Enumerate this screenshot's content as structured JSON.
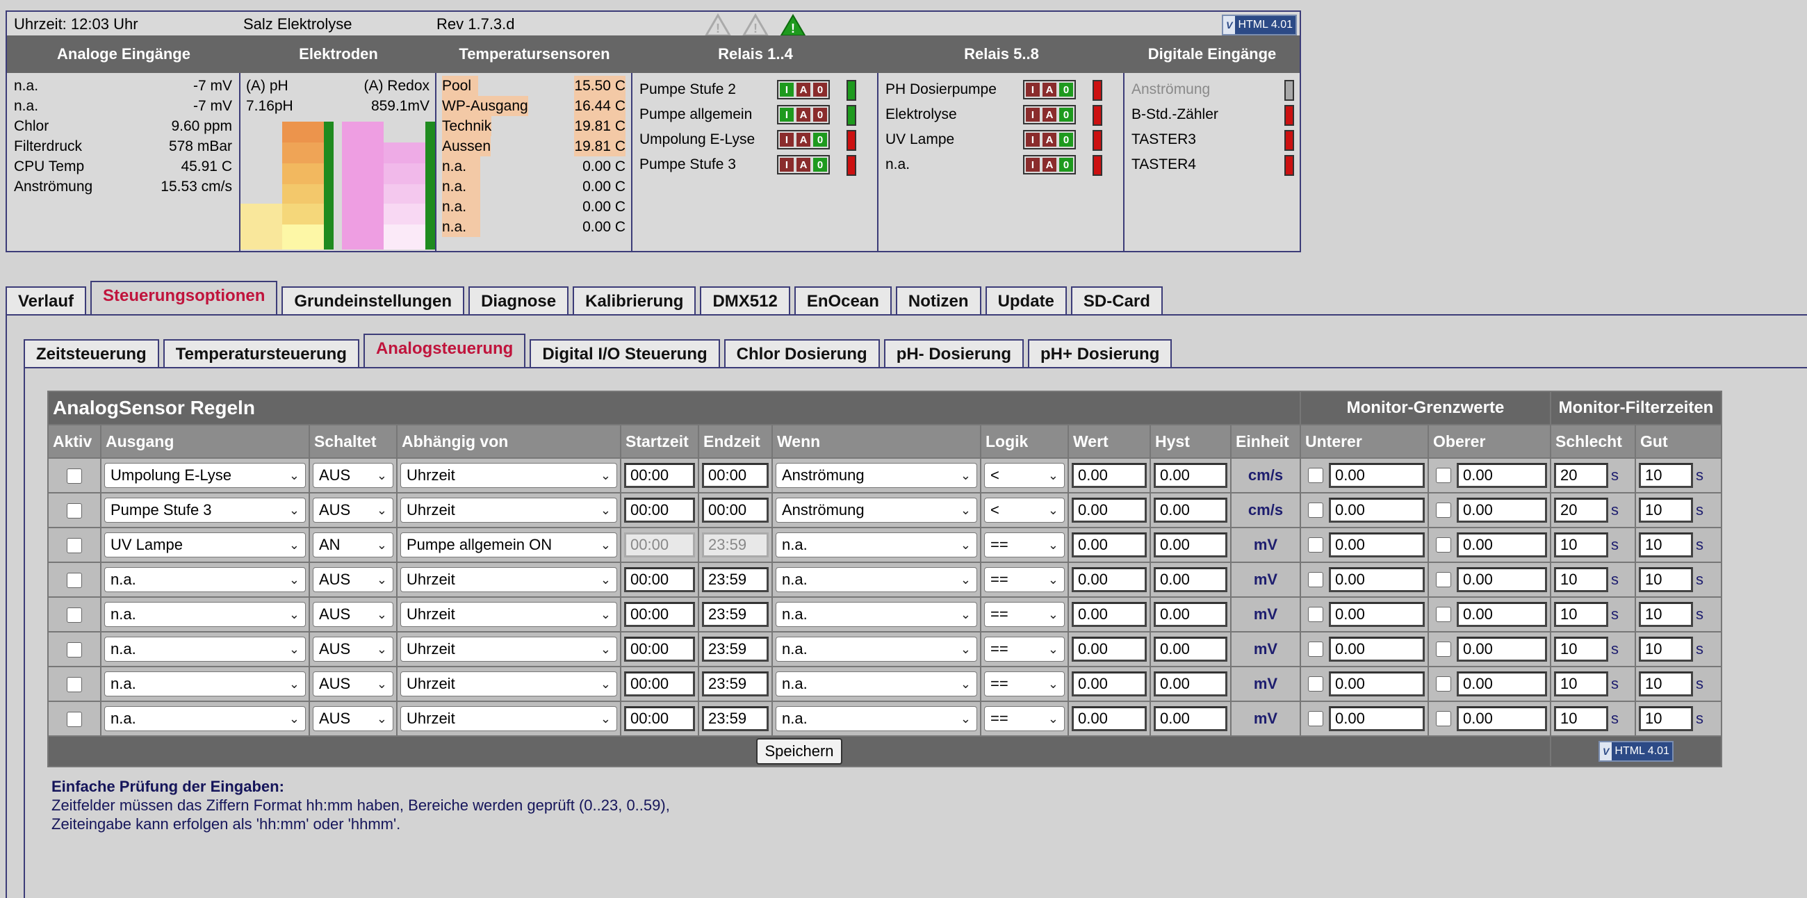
{
  "status": {
    "time": "Uhrzeit: 12:03 Uhr",
    "system": "Salz Elektrolyse",
    "revision": "Rev 1.7.3.d",
    "validator": {
      "left": "V",
      "right": "HTML 4.01"
    }
  },
  "panel": {
    "headers": {
      "analog": "Analoge Eingänge",
      "electrodes": "Elektroden",
      "temps": "Temperatursensoren",
      "relais14": "Relais 1..4",
      "relais58": "Relais 5..8",
      "digital": "Digitale Eingänge"
    },
    "analog": [
      {
        "label": "n.a.",
        "value": "-7 mV"
      },
      {
        "label": "n.a.",
        "value": "-7 mV"
      },
      {
        "label": "Chlor",
        "value": "9.60 ppm"
      },
      {
        "label": "Filterdruck",
        "value": "578 mBar"
      },
      {
        "label": "CPU Temp",
        "value": "45.91 C"
      },
      {
        "label": "Anströmung",
        "value": "15.53 cm/s"
      }
    ],
    "electrodes": {
      "ph_label": "(A) pH",
      "redox_label": "(A) Redox",
      "ph_value": "7.16pH",
      "redox_value": "859.1mV",
      "ph_level": 0.3,
      "redox_level": 0.62
    },
    "temps": [
      {
        "label": "Pool",
        "value": "15.50 C"
      },
      {
        "label": "WP-Ausgang",
        "value": "16.44 C"
      },
      {
        "label": "Technik",
        "value": "19.81 C"
      },
      {
        "label": "Aussen",
        "value": "19.81 C"
      },
      {
        "label": "n.a.",
        "value": "0.00 C"
      },
      {
        "label": "n.a.",
        "value": "0.00 C"
      },
      {
        "label": "n.a.",
        "value": "0.00 C"
      },
      {
        "label": "n.a.",
        "value": "0.00 C"
      }
    ],
    "relais14": [
      {
        "label": "Pumpe Stufe 2",
        "state": "I",
        "on": true
      },
      {
        "label": "Pumpe allgemein",
        "state": "I",
        "on": true
      },
      {
        "label": "Umpolung E-Lyse",
        "state": "0",
        "on": false
      },
      {
        "label": "Pumpe Stufe 3",
        "state": "0",
        "on": false
      }
    ],
    "relais58": [
      {
        "label": "PH Dosierpumpe",
        "state": "0",
        "on": false
      },
      {
        "label": "Elektrolyse",
        "state": "0",
        "on": false
      },
      {
        "label": "UV Lampe",
        "state": "0",
        "on": false
      },
      {
        "label": "n.a.",
        "state": "0",
        "on": false
      }
    ],
    "relais_buttons": [
      "I",
      "A",
      "0"
    ],
    "digital": [
      {
        "label": "Anströmung",
        "active": false,
        "dim": true
      },
      {
        "label": "B-Std.-Zähler",
        "active": true,
        "dim": false
      },
      {
        "label": "TASTER3",
        "active": true,
        "dim": false
      },
      {
        "label": "TASTER4",
        "active": true,
        "dim": false
      }
    ]
  },
  "tabs_main": [
    "Verlauf",
    "Steuerungsoptionen",
    "Grundeinstellungen",
    "Diagnose",
    "Kalibrierung",
    "DMX512",
    "EnOcean",
    "Notizen",
    "Update",
    "SD-Card"
  ],
  "tabs_main_active": 1,
  "tabs_sub": [
    "Zeitsteuerung",
    "Temperatursteuerung",
    "Analogsteuerung",
    "Digital I/O Steuerung",
    "Chlor Dosierung",
    "pH- Dosierung",
    "pH+ Dosierung"
  ],
  "tabs_sub_active": 2,
  "table": {
    "title": "AnalogSensor Regeln",
    "monitor_limits": "Monitor-Grenzwerte",
    "monitor_filter": "Monitor-Filterzeiten",
    "columns": [
      "Aktiv",
      "Ausgang",
      "Schaltet",
      "Abhängig von",
      "Startzeit",
      "Endzeit",
      "Wenn",
      "Logik",
      "Wert",
      "Hyst",
      "Einheit",
      "Unterer",
      "Oberer",
      "Schlecht",
      "Gut"
    ],
    "seconds_suffix": "s",
    "rows": [
      {
        "ausgang": "Umpolung E-Lyse",
        "schaltet": "AUS",
        "abh": "Uhrzeit",
        "start": "00:00",
        "end": "00:00",
        "wenn": "Anströmung",
        "logik": "<",
        "wert": "0.00",
        "hyst": "0.00",
        "einheit": "cm/s",
        "unterer": "0.00",
        "oberer": "0.00",
        "schlecht": "20",
        "gut": "10",
        "disabled": false
      },
      {
        "ausgang": "Pumpe Stufe 3",
        "schaltet": "AUS",
        "abh": "Uhrzeit",
        "start": "00:00",
        "end": "00:00",
        "wenn": "Anströmung",
        "logik": "<",
        "wert": "0.00",
        "hyst": "0.00",
        "einheit": "cm/s",
        "unterer": "0.00",
        "oberer": "0.00",
        "schlecht": "20",
        "gut": "10",
        "disabled": false
      },
      {
        "ausgang": "UV Lampe",
        "schaltet": "AN",
        "abh": "Pumpe allgemein ON",
        "start": "00:00",
        "end": "23:59",
        "wenn": "n.a.",
        "logik": "==",
        "wert": "0.00",
        "hyst": "0.00",
        "einheit": "mV",
        "unterer": "0.00",
        "oberer": "0.00",
        "schlecht": "10",
        "gut": "10",
        "disabled": true
      },
      {
        "ausgang": "n.a.",
        "schaltet": "AUS",
        "abh": "Uhrzeit",
        "start": "00:00",
        "end": "23:59",
        "wenn": "n.a.",
        "logik": "==",
        "wert": "0.00",
        "hyst": "0.00",
        "einheit": "mV",
        "unterer": "0.00",
        "oberer": "0.00",
        "schlecht": "10",
        "gut": "10",
        "disabled": false
      },
      {
        "ausgang": "n.a.",
        "schaltet": "AUS",
        "abh": "Uhrzeit",
        "start": "00:00",
        "end": "23:59",
        "wenn": "n.a.",
        "logik": "==",
        "wert": "0.00",
        "hyst": "0.00",
        "einheit": "mV",
        "unterer": "0.00",
        "oberer": "0.00",
        "schlecht": "10",
        "gut": "10",
        "disabled": false
      },
      {
        "ausgang": "n.a.",
        "schaltet": "AUS",
        "abh": "Uhrzeit",
        "start": "00:00",
        "end": "23:59",
        "wenn": "n.a.",
        "logik": "==",
        "wert": "0.00",
        "hyst": "0.00",
        "einheit": "mV",
        "unterer": "0.00",
        "oberer": "0.00",
        "schlecht": "10",
        "gut": "10",
        "disabled": false
      },
      {
        "ausgang": "n.a.",
        "schaltet": "AUS",
        "abh": "Uhrzeit",
        "start": "00:00",
        "end": "23:59",
        "wenn": "n.a.",
        "logik": "==",
        "wert": "0.00",
        "hyst": "0.00",
        "einheit": "mV",
        "unterer": "0.00",
        "oberer": "0.00",
        "schlecht": "10",
        "gut": "10",
        "disabled": false
      },
      {
        "ausgang": "n.a.",
        "schaltet": "AUS",
        "abh": "Uhrzeit",
        "start": "00:00",
        "end": "23:59",
        "wenn": "n.a.",
        "logik": "==",
        "wert": "0.00",
        "hyst": "0.00",
        "einheit": "mV",
        "unterer": "0.00",
        "oberer": "0.00",
        "schlecht": "10",
        "gut": "10",
        "disabled": false
      }
    ],
    "save_label": "Speichern"
  },
  "notes": {
    "heading": "Einfache Prüfung der Eingaben:",
    "line1": "Zeitfelder müssen das Ziffern Format hh:mm haben, Bereiche werden geprüft (0..23, 0..59),",
    "line2": "Zeiteingabe kann erfolgen als 'hh:mm' oder 'hhmm'."
  },
  "colors": {
    "accent_active_tab": "#c0143c",
    "relay_on": "#1e9a1e",
    "relay_off": "#cc1111",
    "header_bg": "#666666"
  }
}
